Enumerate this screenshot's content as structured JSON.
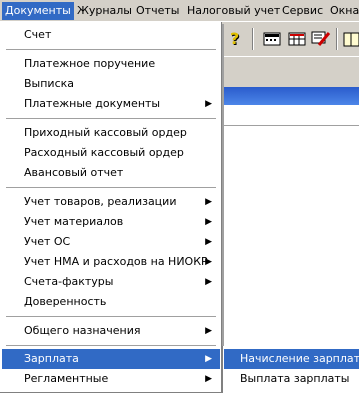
{
  "menubar": {
    "items": [
      {
        "label": "Документы"
      },
      {
        "label": "Журналы"
      },
      {
        "label": "Отчеты"
      },
      {
        "label": "Налоговый учет"
      },
      {
        "label": "Сервис"
      },
      {
        "label": "Окна"
      }
    ]
  },
  "toolbar": {
    "icons": [
      "help-icon",
      "calculator-icon",
      "table-icon",
      "edit-icon",
      "book-icon"
    ]
  },
  "dropdown": {
    "items": [
      {
        "label": "Счет"
      },
      {
        "label": "Платежное поручение"
      },
      {
        "label": "Выписка"
      },
      {
        "label": "Платежные документы"
      },
      {
        "label": "Приходный кассовый ордер"
      },
      {
        "label": "Расходный кассовый ордер"
      },
      {
        "label": "Авансовый отчет"
      },
      {
        "label": "Учет товаров, реализации"
      },
      {
        "label": "Учет материалов"
      },
      {
        "label": "Учет ОС"
      },
      {
        "label": "Учет НМА и расходов на НИОКР"
      },
      {
        "label": "Счета-фактуры"
      },
      {
        "label": "Доверенность"
      },
      {
        "label": "Общего назначения"
      },
      {
        "label": "Зарплата"
      },
      {
        "label": "Регламентные"
      }
    ],
    "submenu_arrow": "▶"
  },
  "submenu": {
    "items": [
      {
        "label": "Начисление зарплаты"
      },
      {
        "label": "Выплата зарплаты"
      }
    ]
  },
  "colors": {
    "highlight": "#316ac5",
    "menu_bg": "#d4d0c8"
  }
}
